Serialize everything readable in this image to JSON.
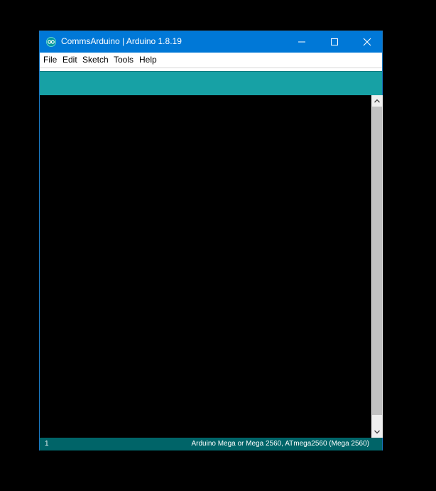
{
  "window": {
    "title": "CommsArduino | Arduino 1.8.19"
  },
  "menu": {
    "items": [
      "File",
      "Edit",
      "Sketch",
      "Tools",
      "Help"
    ]
  },
  "status": {
    "line_number": "1",
    "board": "Arduino Mega or Mega 2560, ATmega2560 (Mega 2560)"
  },
  "icons": {
    "app": "arduino-infinity-icon",
    "minimize": "minimize-icon",
    "maximize": "maximize-icon",
    "close": "close-icon",
    "scroll_up": "chevron-up-icon",
    "scroll_down": "chevron-down-icon"
  },
  "colors": {
    "titlebar": "#0078d7",
    "toolbar": "#17a1a5",
    "statusbar": "#006468",
    "editor_background": "#000000"
  }
}
